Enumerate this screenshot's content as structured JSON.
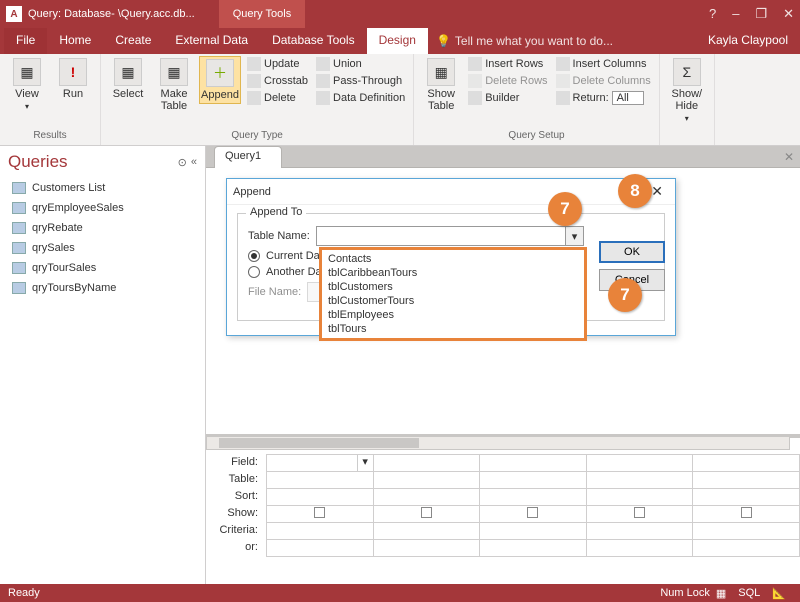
{
  "titlebar": {
    "app_icon": "A",
    "title": "Query: Database- \\Query.acc.db...",
    "context_tab": "Query Tools",
    "min": "–",
    "max": "❐",
    "close": "✕",
    "help": "?"
  },
  "ribbon_tabs": {
    "items": [
      "File",
      "Home",
      "Create",
      "External Data",
      "Database Tools",
      "Design"
    ],
    "active_index": 5,
    "tell_me": "Tell me what you want to do...",
    "user": "Kayla Claypool"
  },
  "ribbon": {
    "results": {
      "view": "View",
      "run": "Run",
      "label": "Results"
    },
    "query_type": {
      "select": "Select",
      "make_table": "Make\nTable",
      "append": "Append",
      "update": "Update",
      "crosstab": "Crosstab",
      "delete": "Delete",
      "union": "Union",
      "passthrough": "Pass-Through",
      "data_def": "Data Definition",
      "label": "Query Type"
    },
    "show_table": {
      "btn": "Show\nTable"
    },
    "query_setup": {
      "insert_rows": "Insert Rows",
      "delete_rows": "Delete Rows",
      "builder": "Builder",
      "insert_cols": "Insert Columns",
      "delete_cols": "Delete Columns",
      "return_lbl": "Return:",
      "return_val": "All",
      "label": "Query Setup"
    },
    "showhide": {
      "btn": "Show/\nHide",
      "label": ""
    }
  },
  "nav": {
    "header": "Queries",
    "items": [
      "Customers List",
      "qryEmployeeSales",
      "qryRebate",
      "qrySales",
      "qryTourSales",
      "qryToursByName"
    ]
  },
  "tab": {
    "name": "Query1"
  },
  "dialog": {
    "title": "Append",
    "group_label": "Append To",
    "table_name_lbl": "Table Name:",
    "current_db": "Current Database",
    "another_db": "Another Database:",
    "file_name_lbl": "File Name:",
    "ok": "OK",
    "cancel": "Cancel",
    "help": "?",
    "close": "✕"
  },
  "dropdown_options": [
    "Contacts",
    "tblCaribbeanTours",
    "tblCustomers",
    "tblCustomerTours",
    "tblEmployees",
    "tblTours"
  ],
  "design_grid": {
    "rows": [
      "Field:",
      "Table:",
      "Sort:",
      "Show:",
      "Criteria:",
      "or:"
    ]
  },
  "callouts": {
    "c7a": "7",
    "c7b": "7",
    "c8": "8"
  },
  "status": {
    "ready": "Ready",
    "numlock": "Num Lock",
    "sql": "SQL"
  }
}
